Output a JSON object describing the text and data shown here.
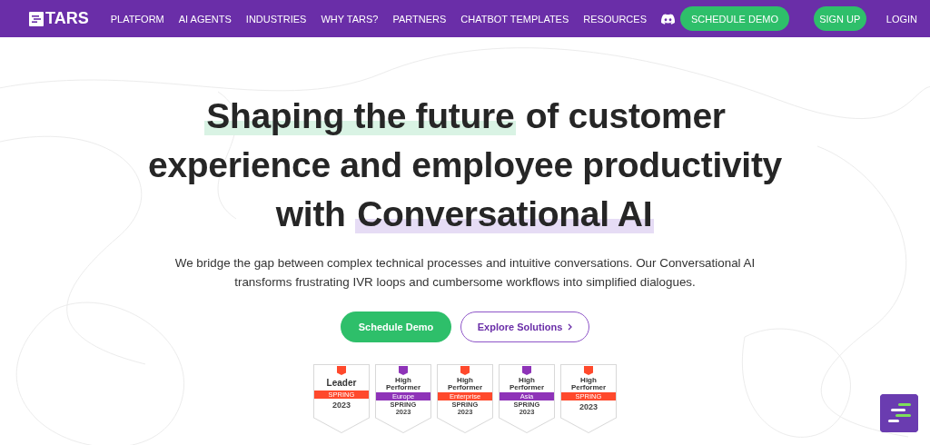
{
  "nav": {
    "logo": "TARS",
    "items": [
      {
        "label": "PLATFORM"
      },
      {
        "label": "AI AGENTS"
      },
      {
        "label": "INDUSTRIES"
      },
      {
        "label": "WHY TARS?"
      },
      {
        "label": "PARTNERS"
      },
      {
        "label": "CHATBOT TEMPLATES"
      },
      {
        "label": "RESOURCES"
      }
    ],
    "cta": "SCHEDULE DEMO",
    "signup": "SIGN UP",
    "login": "LOGIN"
  },
  "hero": {
    "headline": [
      [
        {
          "text": "Shaping the future",
          "color": "#d9f3e4"
        },
        {
          "text": " of customer"
        }
      ],
      [
        {
          "text": "experience and employee productivity"
        }
      ],
      [
        {
          "text": "with "
        },
        {
          "text": "Conversational AI",
          "color": "#e6dcf5"
        }
      ]
    ],
    "subtitle": "We bridge the gap between complex technical processes and intuitive conversations. Our Conversational AI transforms frustrating IVR loops and cumbersome workflows into simplified dialogues.",
    "buttons": [
      {
        "label": "Schedule Demo",
        "kind": "primary"
      },
      {
        "label": "Explore Solutions",
        "kind": "outline"
      }
    ]
  },
  "badges": [
    {
      "title": [
        "Leader"
      ],
      "ribbon": "SPRING",
      "color": "#ff492c",
      "footer": [
        "2023"
      ]
    },
    {
      "title": [
        "High",
        "Performer"
      ],
      "ribbon": "Europe",
      "color": "#8e33b8",
      "footer": [
        "SPRING",
        "2023"
      ]
    },
    {
      "title": [
        "High",
        "Performer"
      ],
      "ribbon": "Enterprise",
      "color": "#ff492c",
      "footer": [
        "SPRING",
        "2023"
      ]
    },
    {
      "title": [
        "High",
        "Performer"
      ],
      "ribbon": "Asia",
      "color": "#8e33b8",
      "footer": [
        "SPRING",
        "2023"
      ]
    },
    {
      "title": [
        "High",
        "Performer"
      ],
      "ribbon": "SPRING",
      "color": "#ff492c",
      "footer": [
        "2023"
      ]
    }
  ]
}
